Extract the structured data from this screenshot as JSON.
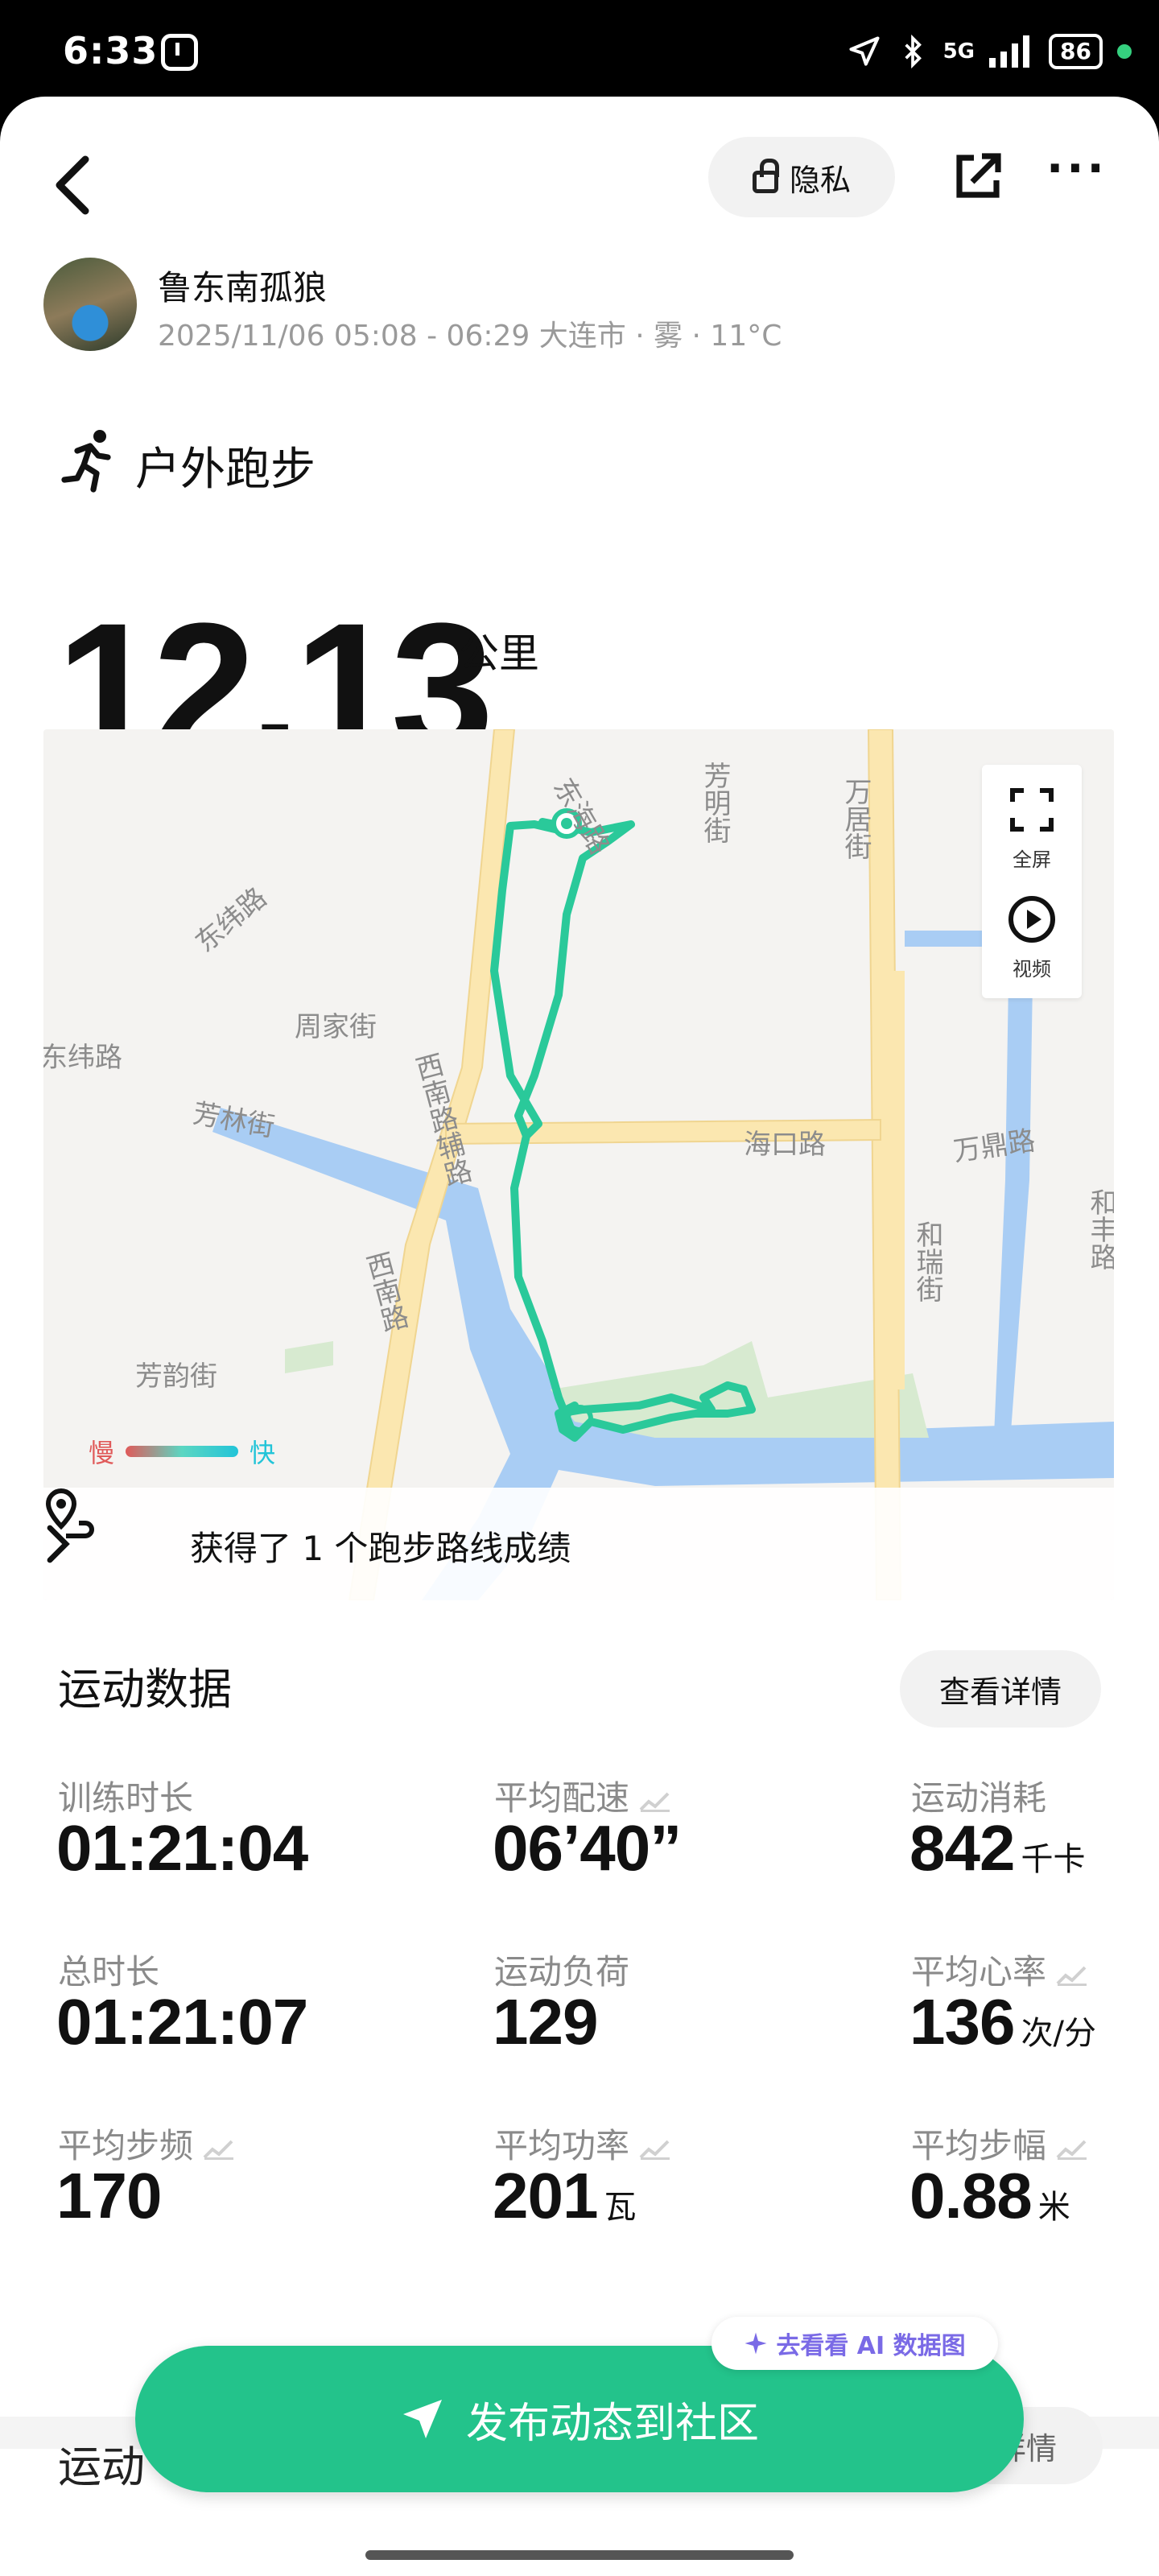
{
  "status_bar": {
    "time": "6:33",
    "network": "5G",
    "battery": "86"
  },
  "topbar": {
    "back_label": "<",
    "privacy_label": "隐私",
    "more_label": "···"
  },
  "user": {
    "name": "鲁东南孤狼",
    "meta": "2025/11/06 05:08 - 06:29 大连市 · 雾 · 11°C"
  },
  "activity": {
    "type": "户外跑步",
    "distance": "12.13",
    "unit": "公里"
  },
  "map": {
    "labels": {
      "donghai_rd": "东海路",
      "fangming_st": "芳明街",
      "wanju_st": "万居街",
      "dongwei_rd": "东纬路",
      "dongwei_rd2": "东纬路",
      "zhoujia_st": "周家街",
      "xinan_fu_rd": "西南路辅路",
      "haikou_rd": "海口路",
      "wanding_rd": "万鼎路",
      "fanglin_st": "芳林街",
      "xinan_rd": "西南路",
      "herui_st": "和瑞街",
      "hefeng_rd": "和丰路",
      "fangyun_st": "芳韵街"
    },
    "fullscreen_label": "全屏",
    "video_label": "视频",
    "legend_slow": "慢",
    "legend_fast": "快",
    "colors": {
      "route": "#2ac99a",
      "road_major": "#fbe7b0",
      "water": "#a9cdf4"
    }
  },
  "achievement": {
    "text": "获得了 1 个跑步路线成绩"
  },
  "stats_section": {
    "title": "运动数据",
    "detail_button": "查看详情",
    "items": [
      {
        "label": "训练时长",
        "value": "01:21:04",
        "unit": ""
      },
      {
        "label": "平均配速",
        "value": "06’40”",
        "unit": ""
      },
      {
        "label": "运动消耗",
        "value": "842",
        "unit": "千卡"
      },
      {
        "label": "总时长",
        "value": "01:21:07",
        "unit": ""
      },
      {
        "label": "运动负荷",
        "value": "129",
        "unit": ""
      },
      {
        "label": "平均心率",
        "value": "136",
        "unit": "次/分"
      },
      {
        "label": "平均步频",
        "value": "170",
        "unit": ""
      },
      {
        "label": "平均功率",
        "value": "201",
        "unit": "瓦"
      },
      {
        "label": "平均步幅",
        "value": "0.88",
        "unit": "米"
      }
    ]
  },
  "section2": {
    "title": "运动",
    "detail_button": "详情"
  },
  "ai_pill": "去看看 AI 数据图",
  "publish_button": "发布动态到社区"
}
